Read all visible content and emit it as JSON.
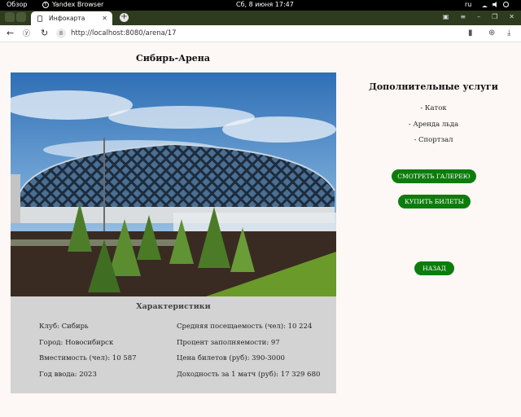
{
  "system_bar": {
    "overview": "Обзор",
    "app_name": "Yandex Browser",
    "app_badge": "Y",
    "clock": "Сб, 8 июня  17:47",
    "lang": "ru"
  },
  "browser": {
    "tab_title": "Инфокарта",
    "new_tab_label": "+",
    "url": "http://localhost:8080/arena/17",
    "url_badge": "8"
  },
  "page": {
    "title": "Сибирь-Арена",
    "specs": {
      "heading": "Характеристики",
      "left": [
        "Клуб: Сибирь",
        "Город: Новосибирск",
        "Вместимость (чел): 10 587",
        "Год ввода: 2023"
      ],
      "right": [
        "Средняя посещаемость (чел): 10 224",
        "Процент заполняемости: 97",
        "Цена билетов (руб): 390-3000",
        "Доходность за 1 матч (руб): 17 329 680"
      ]
    },
    "services": {
      "title": "Дополнительные услуги",
      "items": [
        "- Каток",
        "- Аренда льда",
        "- Спортзал"
      ]
    },
    "buttons": {
      "gallery": "СМОТРЕТЬ ГАЛЕРЕЮ",
      "tickets": "КУПИТЬ БИЛЕТЫ",
      "back": "НАЗАД"
    }
  },
  "colors": {
    "button_bg": "#0c7d0c",
    "specs_bg": "#d3d3d3",
    "page_bg": "#fdf8f5"
  }
}
